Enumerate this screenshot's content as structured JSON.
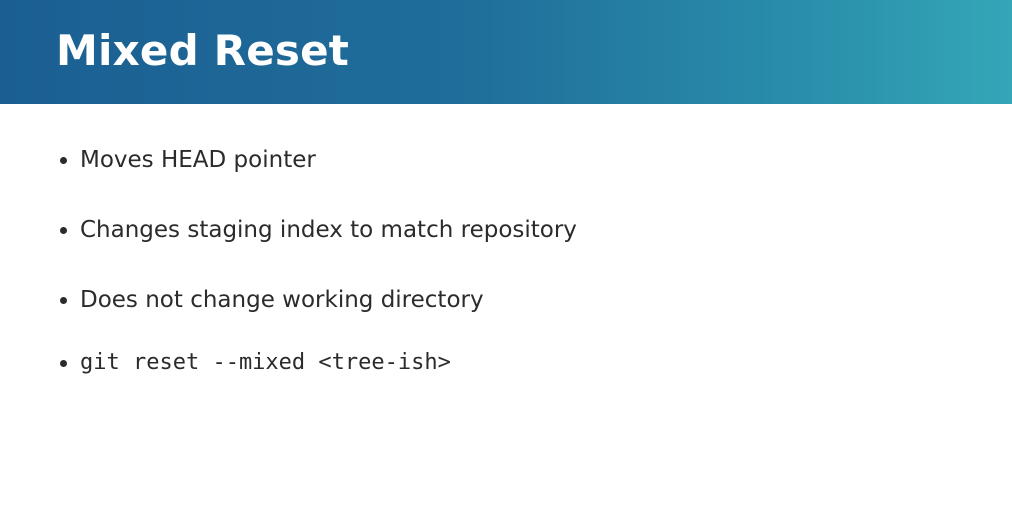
{
  "slide": {
    "title": "Mixed Reset",
    "colors": {
      "header_start": "#1b5f92",
      "header_end": "#34a6b8",
      "text": "#2b2b2b",
      "title_text": "#ffffff"
    },
    "bullets": [
      {
        "text": "Moves HEAD pointer"
      },
      {
        "text": "Changes staging index to match repository"
      },
      {
        "text": "Does not change working directory"
      },
      {
        "text": "git reset --mixed <tree-ish>"
      }
    ]
  }
}
